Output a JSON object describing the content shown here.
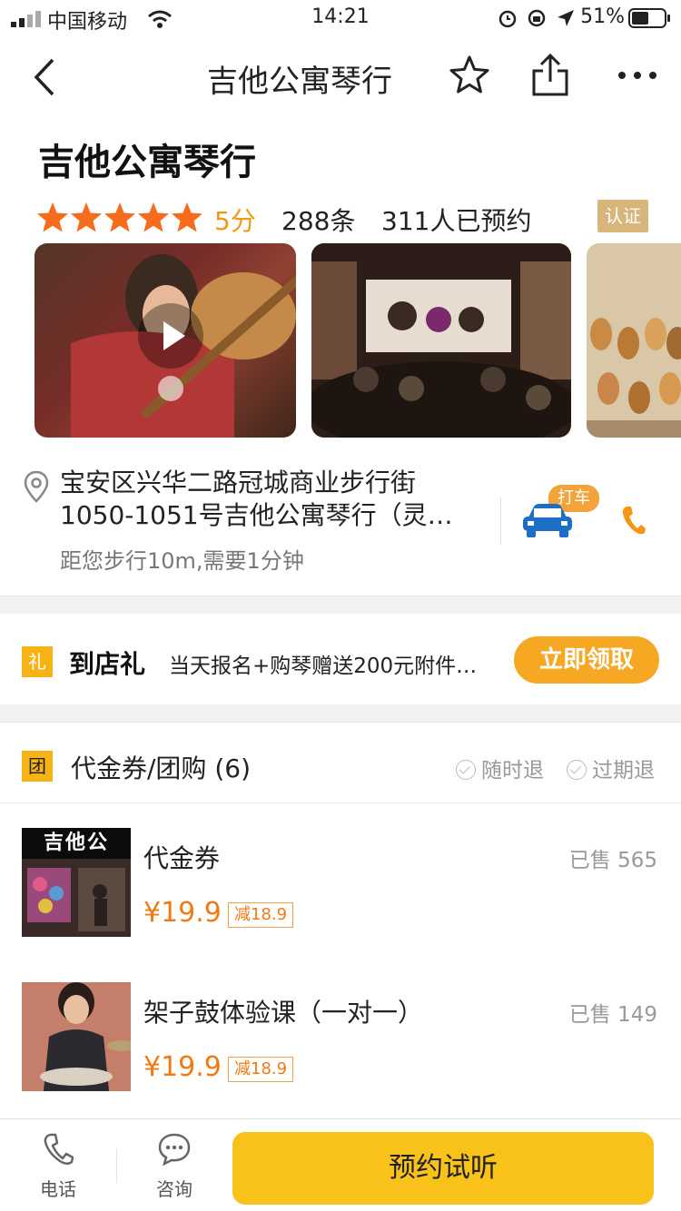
{
  "status_bar": {
    "carrier": "中国移动",
    "time": "14:21",
    "battery": "51%"
  },
  "nav": {
    "title": "吉他公寓琴行"
  },
  "shop": {
    "name": "吉他公寓琴行",
    "rating_stars": 5,
    "score": "5分",
    "reviews": "288条",
    "booked": "311人已预约",
    "cert": "认证"
  },
  "address": {
    "text": "宝安区兴华二路冠城商业步行街1050-1051号吉他公寓琴行（灵…",
    "distance": "距您步行10m,需要1分钟",
    "taxi_badge": "打车"
  },
  "gift": {
    "tag": "礼",
    "title": "到店礼",
    "desc": "当天报名+购琴赠送200元附件…",
    "button": "立即领取"
  },
  "deals_header": {
    "tag": "团",
    "title": "代金券/团购 (6)",
    "refund_anytime": "随时退",
    "refund_expired": "过期退"
  },
  "deals": [
    {
      "name": "代金券",
      "sold": "已售 565",
      "price": "¥19.9",
      "off": "减18.9",
      "thumb_sign": "吉他公"
    },
    {
      "name": "架子鼓体验课（一对一）",
      "sold": "已售 149",
      "price": "¥19.9",
      "off": "减18.9"
    }
  ],
  "bottom": {
    "phone_label": "电话",
    "consult_label": "咨询",
    "book_button": "预约试听"
  },
  "colors": {
    "accent_orange": "#f27a14",
    "star_orange": "#f76b1c",
    "button_yellow": "#f8c21b",
    "gift_button": "#f7a823",
    "taxi_blue": "#1c6fc4"
  }
}
